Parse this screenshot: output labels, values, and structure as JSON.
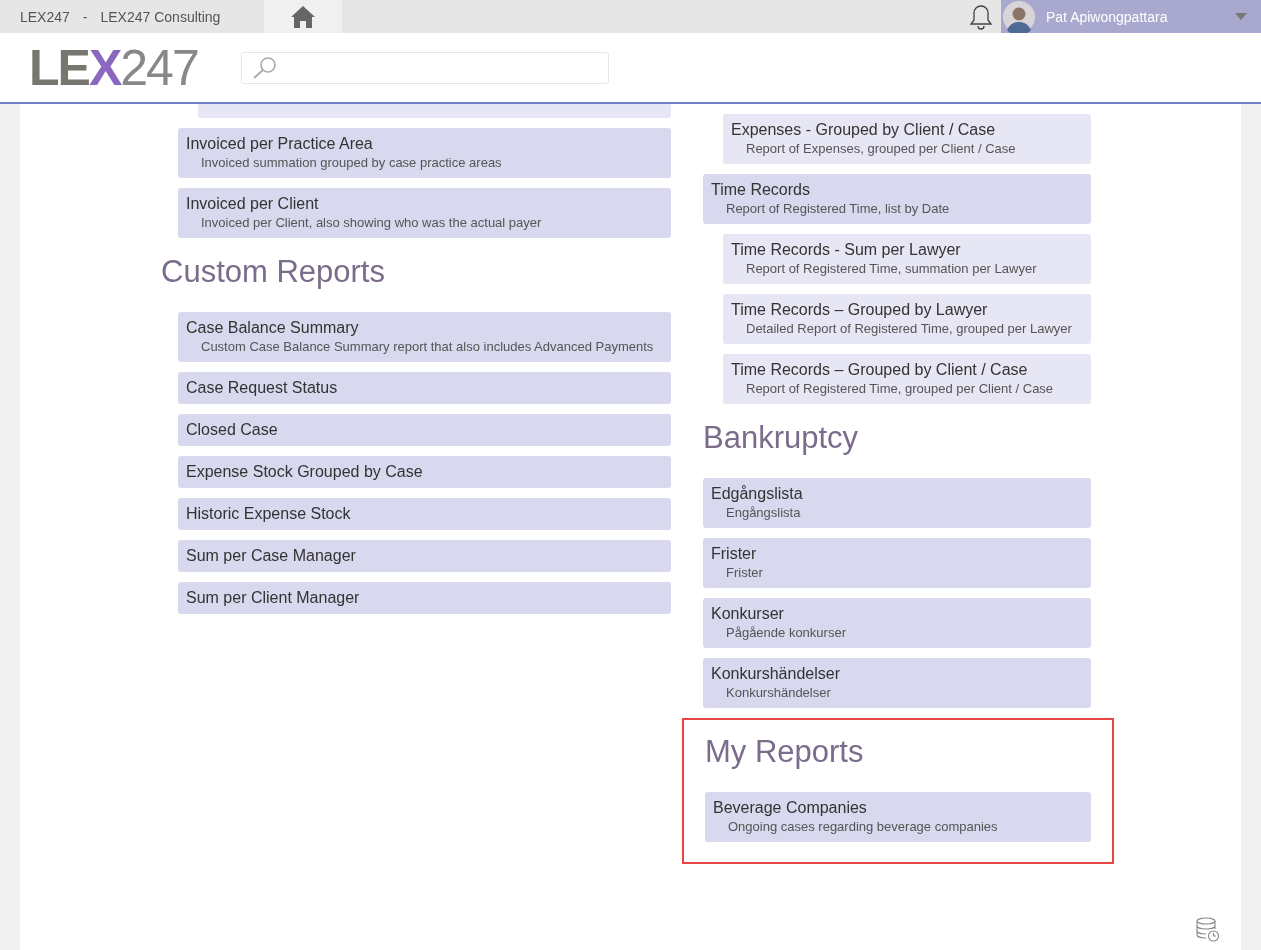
{
  "top_bar": {
    "app": "LEX247",
    "separator": "-",
    "company": "LEX247 Consulting",
    "user": {
      "name": "Pat Apiwongpattara"
    }
  },
  "header": {
    "logo": "LEX247"
  },
  "columns": [
    {
      "sections": [
        {
          "cards": [
            {
              "children": [
                {
                  "partial": true
                }
              ]
            },
            {
              "title": "Invoiced per Practice Area",
              "description": "Invoiced summation grouped by case practice areas"
            },
            {
              "title": "Invoiced per Client",
              "description": "Invoiced per Client, also showing who was the actual payer"
            }
          ]
        },
        {
          "heading": "Custom Reports",
          "highlighted": false,
          "cards": [
            {
              "title": "Case Balance Summary",
              "description": "Custom Case Balance Summary report that also includes Advanced Payments"
            },
            {
              "title": "Case Request Status"
            },
            {
              "title": "Closed Case"
            },
            {
              "title": "Expense Stock Grouped by Case"
            },
            {
              "title": "Historic Expense Stock"
            },
            {
              "title": "Sum per Case Manager"
            },
            {
              "title": "Sum per Client Manager"
            }
          ]
        }
      ]
    },
    {
      "sections": [
        {
          "cards": [
            {
              "children": [
                {
                  "title": "Expenses - Grouped by Client / Case",
                  "description": "Report of Expenses, grouped per Client / Case"
                }
              ]
            },
            {
              "title": "Time Records",
              "description": "Report of Registered Time, list by Date",
              "children": [
                {
                  "title": "Time Records - Sum per Lawyer",
                  "description": "Report of Registered Time, summation per Lawyer"
                },
                {
                  "title": "Time Records – Grouped by Lawyer",
                  "description": "Detailed Report of Registered Time, grouped per Lawyer"
                },
                {
                  "title": "Time Records – Grouped by Client / Case",
                  "description": "Report of Registered Time, grouped per Client / Case"
                }
              ]
            }
          ]
        },
        {
          "heading": "Bankruptcy",
          "highlighted": false,
          "cards": [
            {
              "title": "Edgångslista",
              "description": "Engångslista"
            },
            {
              "title": "Frister",
              "description": "Frister"
            },
            {
              "title": "Konkurser",
              "description": "Pågående konkurser"
            },
            {
              "title": "Konkurshändelser",
              "description": "Konkurshändelser"
            }
          ]
        },
        {
          "heading": "My Reports",
          "highlighted": true,
          "cards": [
            {
              "title": "Beverage Companies",
              "description": "Ongoing cases regarding beverage companies"
            }
          ]
        }
      ]
    }
  ]
}
